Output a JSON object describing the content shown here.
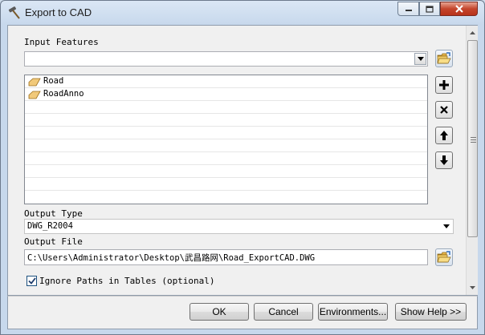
{
  "window": {
    "title": "Export to CAD"
  },
  "input_features": {
    "label": "Input Features",
    "value": "",
    "items": [
      {
        "label": "Road",
        "icon": "polyline-layer-icon"
      },
      {
        "label": "RoadAnno",
        "icon": "polyline-layer-icon"
      }
    ]
  },
  "output_type": {
    "label": "Output Type",
    "value": "DWG_R2004"
  },
  "output_file": {
    "label": "Output File",
    "value": "C:\\Users\\Administrator\\Desktop\\武昌路网\\Road_ExportCAD.DWG"
  },
  "ignore_paths": {
    "label": "Ignore Paths in Tables (optional)",
    "checked": true
  },
  "buttons": {
    "ok": "OK",
    "cancel": "Cancel",
    "environments": "Environments...",
    "show_help": "Show Help >>"
  },
  "colors": {
    "close_button": "#c4452c",
    "layer_icon": "#f1c97a",
    "folder_icon": "#e8b64a"
  }
}
